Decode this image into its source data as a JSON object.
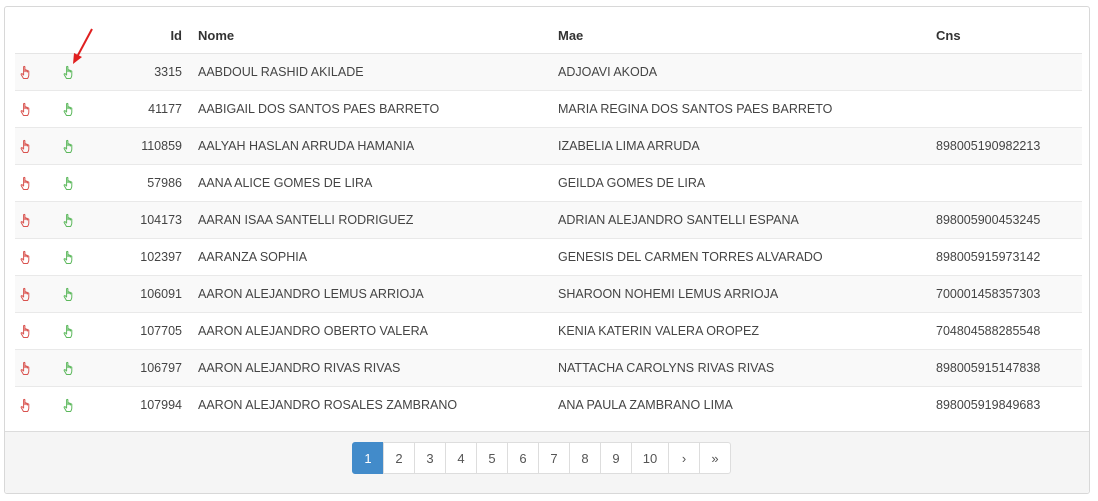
{
  "table": {
    "headers": {
      "id": "Id",
      "nome": "Nome",
      "mae": "Mae",
      "cns": "Cns"
    },
    "rows": [
      {
        "id": "3315",
        "nome": "AABDOUL RASHID AKILADE",
        "mae": "ADJOAVI AKODA",
        "cns": ""
      },
      {
        "id": "41177",
        "nome": "AABIGAIL DOS SANTOS PAES BARRETO",
        "mae": "MARIA REGINA DOS SANTOS PAES BARRETO",
        "cns": ""
      },
      {
        "id": "110859",
        "nome": "AALYAH HASLAN ARRUDA HAMANIA",
        "mae": "IZABELIA LIMA ARRUDA",
        "cns": "898005190982213"
      },
      {
        "id": "57986",
        "nome": "AANA ALICE GOMES DE LIRA",
        "mae": "GEILDA GOMES DE LIRA",
        "cns": ""
      },
      {
        "id": "104173",
        "nome": "AARAN ISAA SANTELLI RODRIGUEZ",
        "mae": "ADRIAN ALEJANDRO SANTELLI ESPANA",
        "cns": "898005900453245"
      },
      {
        "id": "102397",
        "nome": "AARANZA SOPHIA",
        "mae": "GENESIS DEL CARMEN TORRES ALVARADO",
        "cns": "898005915973142"
      },
      {
        "id": "106091",
        "nome": "AARON ALEJANDRO LEMUS ARRIOJA",
        "mae": "SHAROON NOHEMI LEMUS ARRIOJA",
        "cns": "700001458357303"
      },
      {
        "id": "107705",
        "nome": "AARON ALEJANDRO OBERTO VALERA",
        "mae": "KENIA KATERIN VALERA OROPEZ",
        "cns": "704804588285548"
      },
      {
        "id": "106797",
        "nome": "AARON ALEJANDRO RIVAS RIVAS",
        "mae": "NATTACHA CAROLYNS RIVAS RIVAS",
        "cns": "898005915147838"
      },
      {
        "id": "107994",
        "nome": "AARON ALEJANDRO ROSALES ZAMBRANO",
        "mae": "ANA PAULA ZAMBRANO LIMA",
        "cns": "898005919849683"
      }
    ]
  },
  "icons": {
    "select": {
      "name": "hand-pointer-icon",
      "color": "#d9534f"
    },
    "confirm": {
      "name": "hand-pointer-icon",
      "color": "#5cb85c"
    },
    "arrow_color": "#e02020"
  },
  "pagination": {
    "pages": [
      "1",
      "2",
      "3",
      "4",
      "5",
      "6",
      "7",
      "8",
      "9",
      "10"
    ],
    "active": "1",
    "next": "›",
    "last": "»",
    "active_color": "#428bca"
  }
}
